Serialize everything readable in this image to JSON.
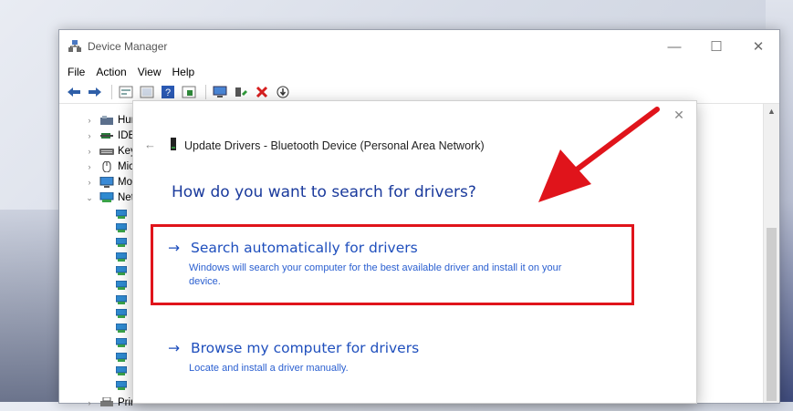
{
  "window": {
    "title": "Device Manager",
    "controls": {
      "minimize": "—",
      "maximize": "☐",
      "close": "✕"
    }
  },
  "menu": [
    "File",
    "Action",
    "View",
    "Help"
  ],
  "toolbar": [
    "back-icon",
    "forward-icon",
    "properties-icon",
    "view-icon",
    "help-icon",
    "details-icon",
    "computer-icon",
    "update-driver-icon",
    "uninstall-icon",
    "disable-icon"
  ],
  "tree": {
    "items": [
      {
        "label": "Hur",
        "expanded": false
      },
      {
        "label": "IDE",
        "expanded": false
      },
      {
        "label": "Key",
        "expanded": false
      },
      {
        "label": "Mic",
        "expanded": false
      },
      {
        "label": "Mo",
        "expanded": false
      },
      {
        "label": "Net",
        "expanded": true
      },
      {
        "label": "Prir",
        "expanded": false
      }
    ],
    "child_count": 13
  },
  "dialog": {
    "title": "Update Drivers - Bluetooth Device (Personal Area Network)",
    "question": "How do you want to search for drivers?",
    "options": [
      {
        "arrow": "→",
        "title": "Search automatically for drivers",
        "description": "Windows will search your computer for the best available driver and install it on your device."
      },
      {
        "arrow": "→",
        "title": "Browse my computer for drivers",
        "description": "Locate and install a driver manually."
      }
    ],
    "close": "✕",
    "back": "←"
  },
  "annotation": {
    "color": "#e0141b"
  }
}
